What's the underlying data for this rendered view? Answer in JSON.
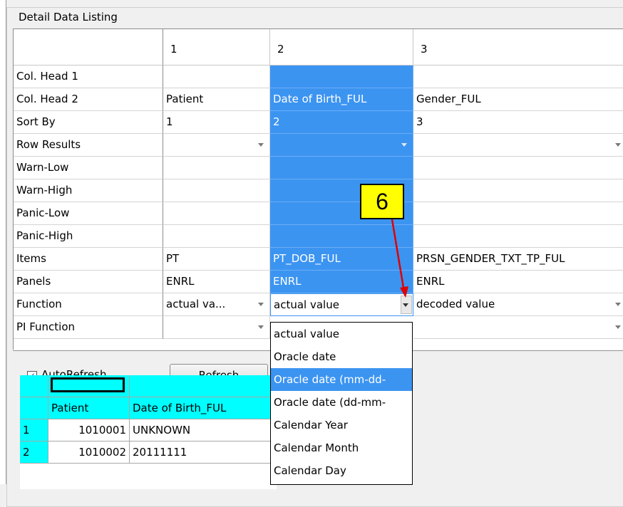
{
  "group_title": "Detail Data Listing",
  "columns": [
    "1",
    "2",
    "3"
  ],
  "row_labels": [
    "Col. Head 1",
    "Col. Head 2",
    "Sort By",
    "Row Results",
    "Warn-Low",
    "Warn-High",
    "Panic-Low",
    "Panic-High",
    "Items",
    "Panels",
    "Function",
    "PI Function"
  ],
  "col1": {
    "col_head_2": "Patient",
    "sort_by": "1",
    "items": "PT",
    "panels": "ENRL",
    "function": "actual va..."
  },
  "col2": {
    "col_head_2": "Date of Birth_FUL",
    "sort_by": "2",
    "items": "PT_DOB_FUL",
    "panels": "ENRL",
    "function": "actual value"
  },
  "col3": {
    "col_head_2": "Gender_FUL",
    "sort_by": "3",
    "items": "PRSN_GENDER_TXT_TP_FUL",
    "panels": "ENRL",
    "function": "decoded value"
  },
  "dropdown_options": [
    "actual value",
    "Oracle date",
    "Oracle date (mm-dd-",
    "Oracle date (dd-mm-",
    "Calendar Year",
    "Calendar Month",
    "Calendar Day"
  ],
  "dropdown_highlighted_index": 2,
  "callout_number": "6",
  "autorefresh": {
    "label": "AutoRefresh",
    "checked": true,
    "check_glyph": "✓"
  },
  "refresh_label": "Refresh",
  "results": {
    "headers": [
      "Patient",
      "Date of Birth_FUL"
    ],
    "rows": [
      {
        "num": "1",
        "patient": "1010001",
        "dob": "UNKNOWN"
      },
      {
        "num": "2",
        "patient": "1010002",
        "dob": "20111111"
      }
    ]
  },
  "colors": {
    "selection": "#3c94f1",
    "callout": "#ffff00",
    "arrow": "#e00000",
    "cyan": "#00ffff"
  }
}
